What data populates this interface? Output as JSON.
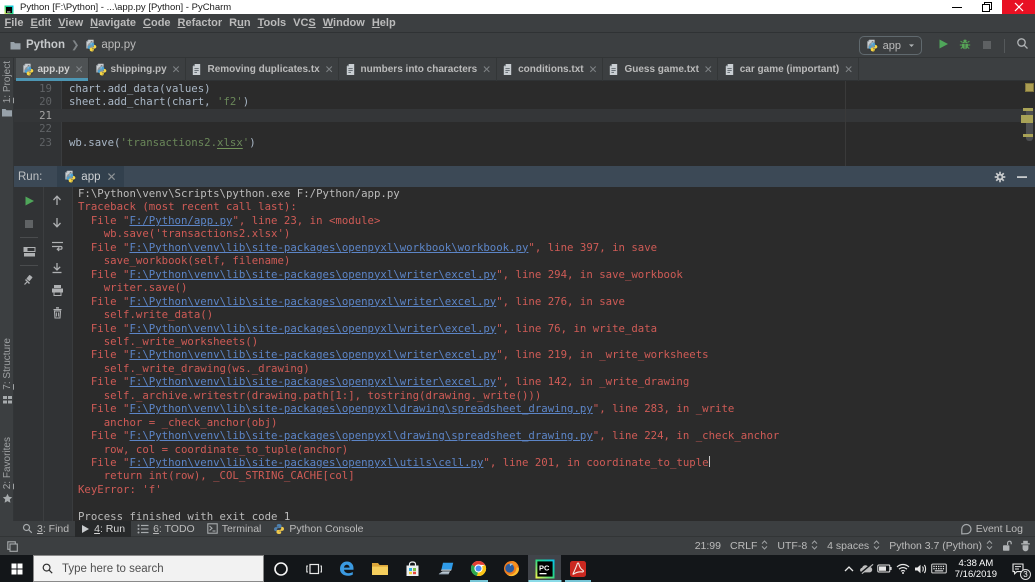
{
  "window": {
    "title": "Python [F:\\Python] - ...\\app.py [Python] - PyCharm",
    "controls": [
      {
        "name": "minimize",
        "icon": "minimize-icon"
      },
      {
        "name": "maximize",
        "icon": "maximize-icon"
      },
      {
        "name": "close",
        "icon": "close-icon"
      }
    ]
  },
  "menu": {
    "items": [
      {
        "label": "File",
        "u": 0
      },
      {
        "label": "Edit",
        "u": 0
      },
      {
        "label": "View",
        "u": 0
      },
      {
        "label": "Navigate",
        "u": 0
      },
      {
        "label": "Code",
        "u": 0
      },
      {
        "label": "Refactor",
        "u": 0
      },
      {
        "label": "Run",
        "u": 1
      },
      {
        "label": "Tools",
        "u": 0
      },
      {
        "label": "VCS",
        "u": 2
      },
      {
        "label": "Window",
        "u": 0
      },
      {
        "label": "Help",
        "u": 0
      }
    ]
  },
  "breadcrumb": {
    "items": [
      {
        "label": "Python",
        "icon": "folder-icon"
      },
      {
        "label": "app.py",
        "icon": "python-file-icon"
      }
    ]
  },
  "run_widget": {
    "config_name": "app",
    "icon": "python-file-icon",
    "buttons": [
      "run-icon",
      "debug-icon",
      "stop-icon-disabled",
      "search-icon"
    ]
  },
  "stripe_left": [
    {
      "label": "1: Project",
      "u": 0,
      "icon": "project-folder-icon"
    },
    {
      "label": "7: Structure",
      "u": 0,
      "icon": "structure-icon"
    },
    {
      "label": "2: Favorites",
      "u": 0,
      "icon": "star-icon"
    }
  ],
  "tabs": [
    {
      "label": "app.py",
      "icon": "python-file-icon",
      "active": true
    },
    {
      "label": "shipping.py",
      "icon": "python-file-icon",
      "active": false
    },
    {
      "label": "Removing duplicates.tx",
      "icon": "text-file-icon",
      "active": false
    },
    {
      "label": "numbers into characters",
      "icon": "text-file-icon",
      "active": false
    },
    {
      "label": "conditions.txt",
      "icon": "text-file-icon",
      "active": false
    },
    {
      "label": "Guess game.txt",
      "icon": "text-file-icon",
      "active": false
    },
    {
      "label": "car game (important)",
      "icon": "text-file-icon",
      "active": false
    }
  ],
  "editor": {
    "current_line": 21,
    "lines": [
      {
        "number": "19",
        "segments": [
          {
            "t": "chart.add_data(values)",
            "c": "d"
          }
        ]
      },
      {
        "number": "20",
        "segments": [
          {
            "t": "sheet.add_chart(chart, ",
            "c": "d"
          },
          {
            "t": "'f2'",
            "c": "s"
          },
          {
            "t": ")",
            "c": "d"
          }
        ]
      },
      {
        "number": "21",
        "segments": []
      },
      {
        "number": "22",
        "segments": []
      },
      {
        "number": "23",
        "segments": [
          {
            "t": "wb.save(",
            "c": "d"
          },
          {
            "t": "'transactions2.",
            "c": "s"
          },
          {
            "t": "xlsx",
            "c": "su"
          },
          {
            "t": "'",
            "c": "s"
          },
          {
            "t": ")",
            "c": "d"
          }
        ]
      }
    ]
  },
  "run_panel": {
    "label": "Run:",
    "tab": {
      "label": "app",
      "icon": "python-file-icon"
    },
    "header_buttons": [
      "gear-icon",
      "hide-icon"
    ],
    "toolbar_col1": [
      "rerun-icon",
      "stop-icon",
      "divider",
      "restore-layout-icon",
      "divider",
      "pin-icon"
    ],
    "toolbar_col2": [
      "up-icon",
      "down-icon",
      "softwrap-icon",
      "scroll-end-icon",
      "print-icon",
      "trash-icon"
    ],
    "console_lines": [
      {
        "segments": [
          {
            "t": "F:\\Python\\venv\\Scripts\\python.exe F:/Python/app.py",
            "c": "out"
          }
        ]
      },
      {
        "segments": [
          {
            "t": "Traceback (most recent call last):",
            "c": "err"
          }
        ]
      },
      {
        "segments": [
          {
            "t": "  File \"",
            "c": "err"
          },
          {
            "t": "F:/Python/app.py",
            "c": "lnk"
          },
          {
            "t": "\", line 23, in <module>",
            "c": "err"
          }
        ]
      },
      {
        "segments": [
          {
            "t": "    wb.save('transactions2.xlsx')",
            "c": "err"
          }
        ]
      },
      {
        "segments": [
          {
            "t": "  File \"",
            "c": "err"
          },
          {
            "t": "F:\\Python\\venv\\lib\\site-packages\\openpyxl\\workbook\\workbook.py",
            "c": "lnk"
          },
          {
            "t": "\", line 397, in save",
            "c": "err"
          }
        ]
      },
      {
        "segments": [
          {
            "t": "    save_workbook(self, filename)",
            "c": "err"
          }
        ]
      },
      {
        "segments": [
          {
            "t": "  File \"",
            "c": "err"
          },
          {
            "t": "F:\\Python\\venv\\lib\\site-packages\\openpyxl\\writer\\excel.py",
            "c": "lnk"
          },
          {
            "t": "\", line 294, in save_workbook",
            "c": "err"
          }
        ]
      },
      {
        "segments": [
          {
            "t": "    writer.save()",
            "c": "err"
          }
        ]
      },
      {
        "segments": [
          {
            "t": "  File \"",
            "c": "err"
          },
          {
            "t": "F:\\Python\\venv\\lib\\site-packages\\openpyxl\\writer\\excel.py",
            "c": "lnk"
          },
          {
            "t": "\", line 276, in save",
            "c": "err"
          }
        ]
      },
      {
        "segments": [
          {
            "t": "    self.write_data()",
            "c": "err"
          }
        ]
      },
      {
        "segments": [
          {
            "t": "  File \"",
            "c": "err"
          },
          {
            "t": "F:\\Python\\venv\\lib\\site-packages\\openpyxl\\writer\\excel.py",
            "c": "lnk"
          },
          {
            "t": "\", line 76, in write_data",
            "c": "err"
          }
        ]
      },
      {
        "segments": [
          {
            "t": "    self._write_worksheets()",
            "c": "err"
          }
        ]
      },
      {
        "segments": [
          {
            "t": "  File \"",
            "c": "err"
          },
          {
            "t": "F:\\Python\\venv\\lib\\site-packages\\openpyxl\\writer\\excel.py",
            "c": "lnk"
          },
          {
            "t": "\", line 219, in _write_worksheets",
            "c": "err"
          }
        ]
      },
      {
        "segments": [
          {
            "t": "    self._write_drawing(ws._drawing)",
            "c": "err"
          }
        ]
      },
      {
        "segments": [
          {
            "t": "  File \"",
            "c": "err"
          },
          {
            "t": "F:\\Python\\venv\\lib\\site-packages\\openpyxl\\writer\\excel.py",
            "c": "lnk"
          },
          {
            "t": "\", line 142, in _write_drawing",
            "c": "err"
          }
        ]
      },
      {
        "segments": [
          {
            "t": "    self._archive.writestr(drawing.path[1:], tostring(drawing._write()))",
            "c": "err"
          }
        ]
      },
      {
        "segments": [
          {
            "t": "  File \"",
            "c": "err"
          },
          {
            "t": "F:\\Python\\venv\\lib\\site-packages\\openpyxl\\drawing\\spreadsheet_drawing.py",
            "c": "lnk"
          },
          {
            "t": "\", line 283, in _write",
            "c": "err"
          }
        ]
      },
      {
        "segments": [
          {
            "t": "    anchor = _check_anchor(obj)",
            "c": "err"
          }
        ]
      },
      {
        "segments": [
          {
            "t": "  File \"",
            "c": "err"
          },
          {
            "t": "F:\\Python\\venv\\lib\\site-packages\\openpyxl\\drawing\\spreadsheet_drawing.py",
            "c": "lnk"
          },
          {
            "t": "\", line 224, in _check_anchor",
            "c": "err"
          }
        ]
      },
      {
        "segments": [
          {
            "t": "    row, col = coordinate_to_tuple(anchor)",
            "c": "err"
          }
        ]
      },
      {
        "segments": [
          {
            "t": "  File \"",
            "c": "err"
          },
          {
            "t": "F:\\Python\\venv\\lib\\site-packages\\openpyxl\\utils\\cell.py",
            "c": "lnk"
          },
          {
            "t": "\", line 201, in coordinate_to_tuple",
            "c": "err"
          }
        ],
        "caret": true
      },
      {
        "segments": [
          {
            "t": "    return int(row), _COL_STRING_CACHE[col]",
            "c": "err"
          }
        ]
      },
      {
        "segments": [
          {
            "t": "KeyError: 'f'",
            "c": "err"
          }
        ]
      },
      {
        "segments": []
      },
      {
        "segments": [
          {
            "t": "Process finished with exit code 1",
            "c": "out"
          }
        ]
      }
    ]
  },
  "toolwindow_bar": {
    "left": [
      {
        "label": "3: Find",
        "u": 0,
        "icon": "find-icon",
        "active": false
      },
      {
        "label": "4: Run",
        "u": 0,
        "icon": "play-icon",
        "active": true
      },
      {
        "label": "6: TODO",
        "u": 0,
        "icon": "todo-icon",
        "active": false
      },
      {
        "label": "Terminal",
        "u": -1,
        "icon": "terminal-icon",
        "active": false
      },
      {
        "label": "Python Console",
        "u": -1,
        "icon": "python-console-icon",
        "active": false
      }
    ],
    "right": [
      {
        "label": "Event Log",
        "icon": "event-log-icon"
      }
    ]
  },
  "statusbar": {
    "position": "21:99",
    "line_ending": "CRLF",
    "encoding": "UTF-8",
    "indent": "4 spaces",
    "interpreter": "Python 3.7 (Python)",
    "icons": [
      "lock-icon",
      "hector-icon"
    ]
  },
  "taskbar": {
    "search_placeholder": "Type here to search",
    "apps": [
      {
        "name": "cortana",
        "icon": "cortana-icon"
      },
      {
        "name": "task-view",
        "icon": "task-view-icon"
      },
      {
        "name": "edge",
        "icon": "edge-icon"
      },
      {
        "name": "file-explorer",
        "icon": "explorer-icon"
      },
      {
        "name": "store",
        "icon": "store-icon"
      },
      {
        "name": "connect",
        "icon": "laptop-icon"
      },
      {
        "name": "chrome",
        "icon": "chrome-icon",
        "running": true
      },
      {
        "name": "firefox",
        "icon": "firefox-icon"
      },
      {
        "name": "pycharm",
        "icon": "pycharm-icon",
        "running": true,
        "focused": true
      },
      {
        "name": "acrobat",
        "icon": "acrobat-icon",
        "running": true
      }
    ],
    "tray": [
      "chevron-up-icon",
      "onedrive-off-icon",
      "battery-icon",
      "wifi-icon",
      "volume-icon",
      "keyboard-icon"
    ],
    "clock": {
      "time": "4:38 AM",
      "date": "7/16/2019"
    },
    "action_center": {
      "icon": "action-center-icon",
      "badge": "3"
    }
  },
  "colors": {
    "accent_tab_underline": "#4d96b3",
    "error_red": "#cf5b56",
    "link_blue": "#5c85c7",
    "string_green": "#6a8759",
    "editor_bg": "#2b2b2b",
    "panel_bg": "#3c3f41",
    "run_header_bg": "#3c4956",
    "close_button_red": "#e81123",
    "taskbar_underline": "#76c5d6"
  }
}
